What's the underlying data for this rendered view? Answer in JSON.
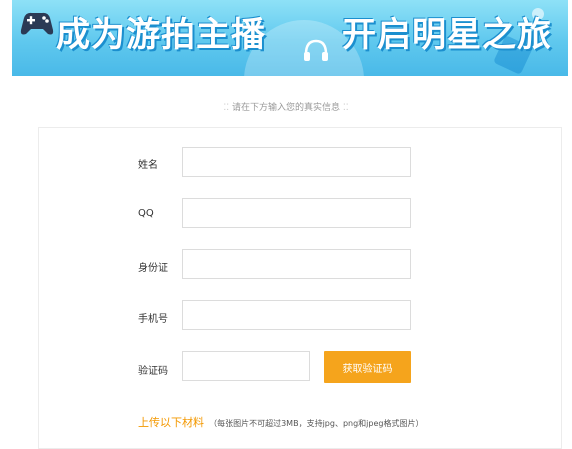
{
  "banner": {
    "title_left": "成为游拍主播",
    "title_right": "开启明星之旅"
  },
  "hint": {
    "text": "请在下方输入您的真实信息"
  },
  "form": {
    "fields": [
      {
        "label": "姓名",
        "value": ""
      },
      {
        "label": "QQ",
        "value": ""
      },
      {
        "label": "身份证",
        "value": ""
      },
      {
        "label": "手机号",
        "value": ""
      },
      {
        "label": "验证码",
        "value": ""
      }
    ],
    "get_code_button": "获取验证码"
  },
  "upload": {
    "title": "上传以下材料",
    "note": "（每张图片不可超过3MB，支持jpg、png和jpeg格式图片）"
  },
  "colors": {
    "banner": "#5fc8ee",
    "accent": "#f5a41c",
    "upload_text": "#f39800"
  },
  "icons": [
    "gamepad-icon",
    "headphone-icon"
  ]
}
